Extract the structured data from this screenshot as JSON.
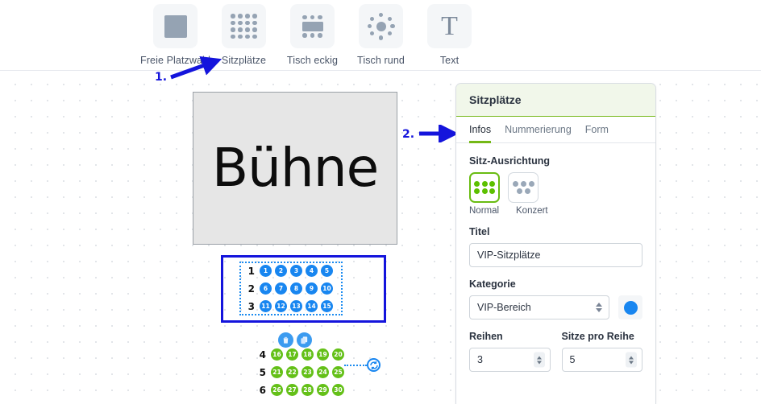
{
  "toolbar": {
    "items": [
      {
        "label": "Freie Platzwahl",
        "icon": "filled-square-icon"
      },
      {
        "label": "Sitzplätze",
        "icon": "seat-grid-icon"
      },
      {
        "label": "Tisch eckig",
        "icon": "rect-table-icon"
      },
      {
        "label": "Tisch rund",
        "icon": "round-table-icon"
      },
      {
        "label": "Text",
        "icon": "text-tool-icon"
      }
    ]
  },
  "annotations": [
    {
      "label": "1.",
      "arrow": "arrow-up-right"
    },
    {
      "label": "2.",
      "arrow": "arrow-right"
    }
  ],
  "canvas": {
    "stage_label": "Bühne",
    "selected_block": {
      "rows": [
        {
          "row_label": "1",
          "seats": [
            "1",
            "2",
            "3",
            "4",
            "5"
          ]
        },
        {
          "row_label": "2",
          "seats": [
            "6",
            "7",
            "8",
            "9",
            "10"
          ]
        },
        {
          "row_label": "3",
          "seats": [
            "11",
            "12",
            "13",
            "14",
            "15"
          ]
        }
      ],
      "seat_color": "#1886f0",
      "selection_border_color": "#1414dc"
    },
    "second_block": {
      "rows": [
        {
          "row_label": "4",
          "seats": [
            "16",
            "17",
            "18",
            "19",
            "20"
          ]
        },
        {
          "row_label": "5",
          "seats": [
            "21",
            "22",
            "23",
            "24",
            "25"
          ]
        },
        {
          "row_label": "6",
          "seats": [
            "26",
            "27",
            "28",
            "29",
            "30"
          ]
        }
      ],
      "seat_color": "#64c018"
    },
    "actions": [
      {
        "name": "delete-icon",
        "glyph": "🗑"
      },
      {
        "name": "duplicate-icon",
        "glyph": "⧉"
      }
    ],
    "rotate_handle": {
      "name": "rotate-icon"
    }
  },
  "panel": {
    "title": "Sitzplätze",
    "tabs": [
      {
        "label": "Infos",
        "active": true
      },
      {
        "label": "Nummerierung",
        "active": false
      },
      {
        "label": "Form",
        "active": false
      }
    ],
    "orientation": {
      "label": "Sitz-Ausrichtung",
      "options": [
        {
          "label": "Normal",
          "selected": true
        },
        {
          "label": "Konzert",
          "selected": false
        }
      ],
      "selected_color": "#69bc12"
    },
    "titel": {
      "label": "Titel",
      "value": "VIP-Sitzplätze",
      "placeholder": "Titel"
    },
    "kategorie": {
      "label": "Kategorie",
      "value": "VIP-Bereich",
      "options": [
        "VIP-Bereich"
      ],
      "color": "#1886f0"
    },
    "reihen": {
      "label": "Reihen",
      "value": "3"
    },
    "sitze_pro_reihe": {
      "label": "Sitze pro Reihe",
      "value": "5"
    }
  }
}
